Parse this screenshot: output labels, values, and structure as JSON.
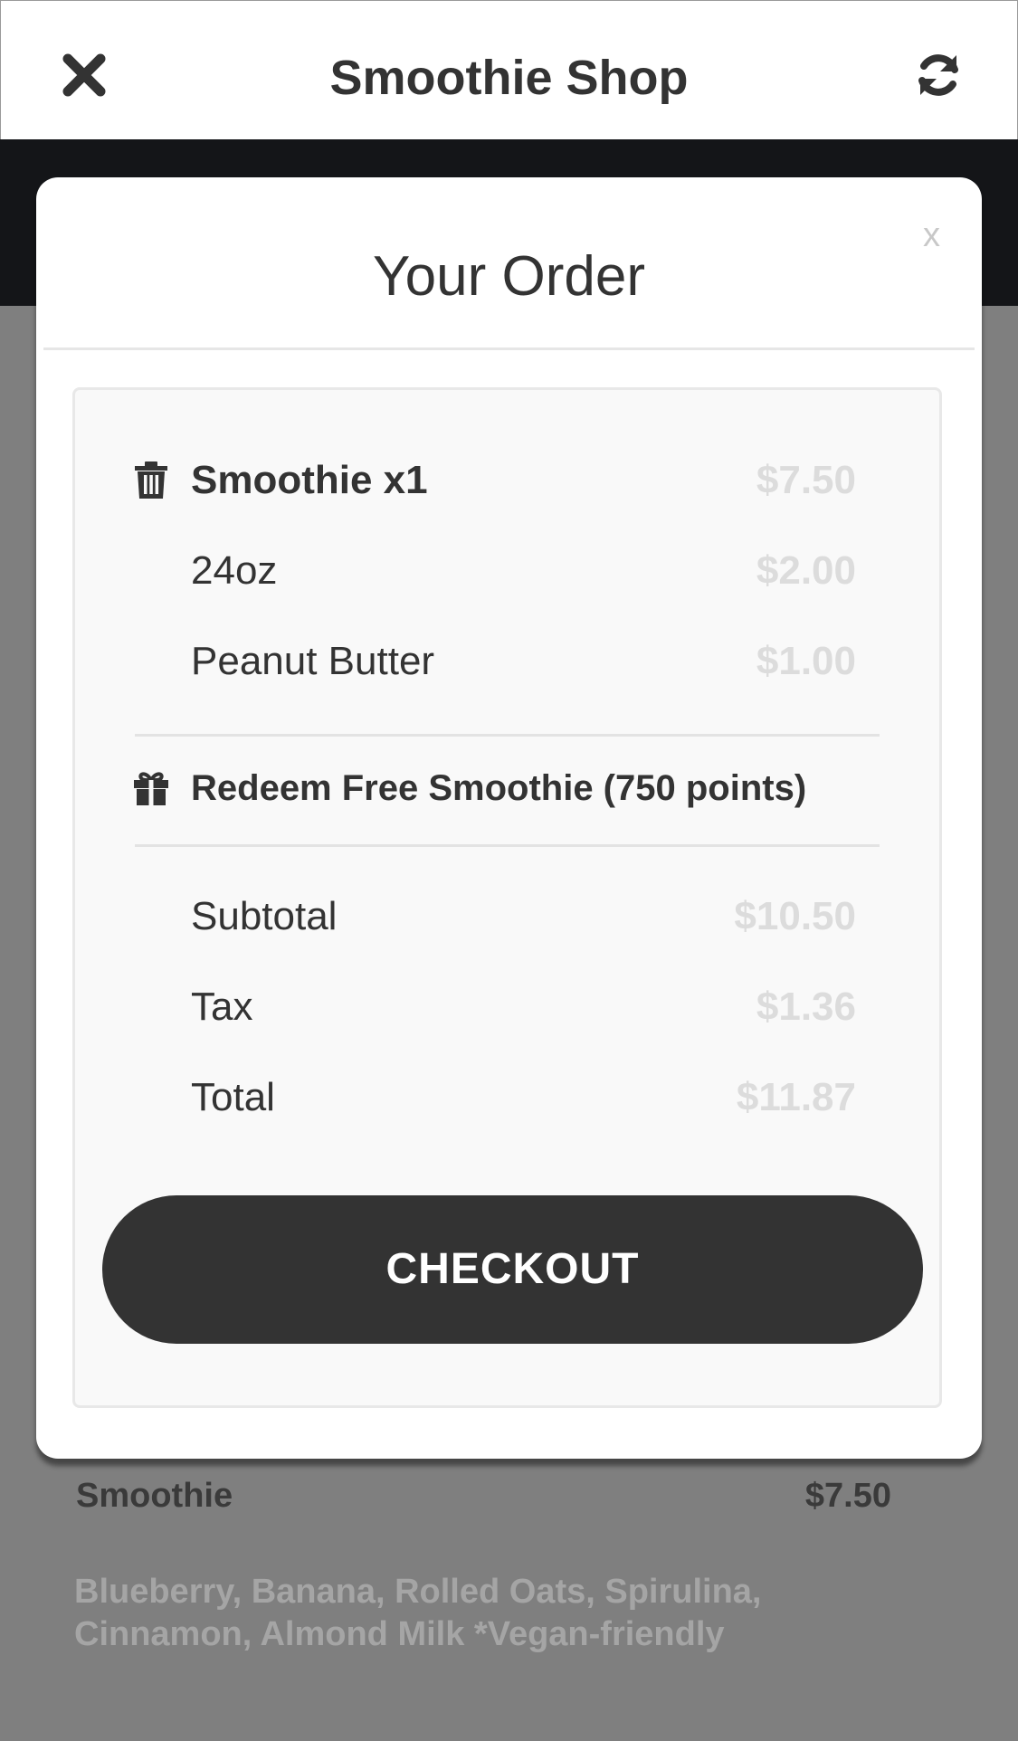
{
  "header": {
    "title": "Smoothie Shop",
    "close_icon": "close-icon",
    "refresh_icon": "refresh-icon"
  },
  "background_item": {
    "name": "Smoothie",
    "price": "$7.50",
    "description": "Blueberry, Banana, Rolled Oats, Spirulina, Cinnamon, Almond Milk *Vegan-friendly"
  },
  "modal": {
    "title": "Your Order",
    "close_label": "x",
    "items": [
      {
        "label": "Smoothie x1",
        "value": "$7.50",
        "icon": "trash-icon"
      },
      {
        "label": "24oz",
        "value": "$2.00"
      },
      {
        "label": "Peanut Butter",
        "value": "$1.00"
      }
    ],
    "redeem": {
      "label": "Redeem Free Smoothie (750 points)",
      "icon": "gift-icon"
    },
    "totals": [
      {
        "label": "Subtotal",
        "value": "$10.50"
      },
      {
        "label": "Tax",
        "value": "$1.36"
      },
      {
        "label": "Total",
        "value": "$11.87"
      }
    ],
    "checkout_label": "CHECKOUT"
  },
  "colors": {
    "header_bg": "#ffffff",
    "dark_band": "#141518",
    "overlay": "#7f7f7f",
    "button_bg": "#333333",
    "price_text": "#dcdcdc"
  }
}
